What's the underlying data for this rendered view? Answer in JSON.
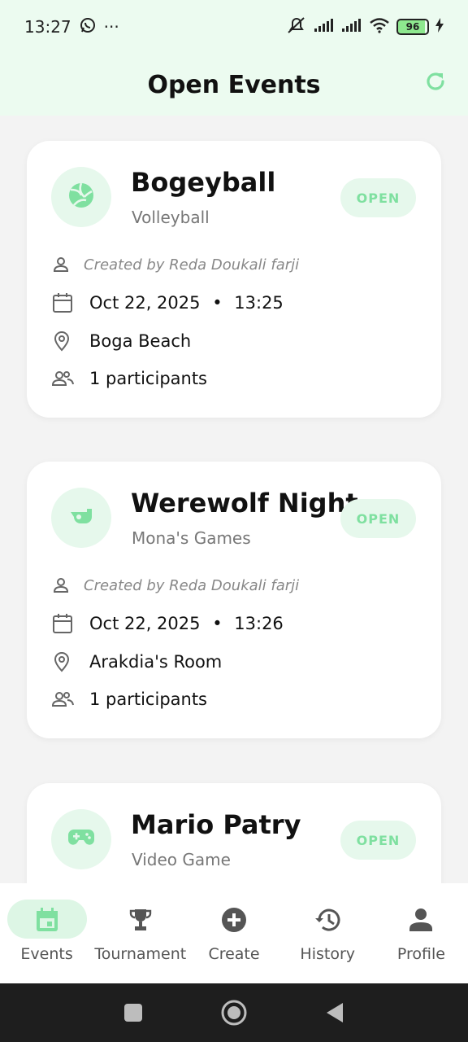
{
  "status_bar": {
    "time": "13:27",
    "more": "···",
    "battery": "96"
  },
  "header": {
    "title": "Open Events"
  },
  "events": [
    {
      "title": "Bogeyball",
      "category": "Volleyball",
      "icon": "volleyball-icon",
      "status": "OPEN",
      "creator": "Created by Reda Doukali farji",
      "date": "Oct 22, 2025",
      "separator": "•",
      "time": "13:25",
      "location": "Boga Beach",
      "participants": "1 participants"
    },
    {
      "title": "Werewolf Night",
      "category": "Mona's Games",
      "icon": "whistle-icon",
      "status": "OPEN",
      "creator": "Created by Reda Doukali farji",
      "date": "Oct 22, 2025",
      "separator": "•",
      "time": "13:26",
      "location": "Arakdia's Room",
      "participants": "1 participants"
    },
    {
      "title": "Mario Patry",
      "category": "Video Game",
      "icon": "gamepad-icon",
      "status": "OPEN"
    }
  ],
  "bottom_nav": {
    "items": [
      {
        "label": "Events",
        "icon": "calendar-icon",
        "active": true
      },
      {
        "label": "Tournament",
        "icon": "trophy-icon",
        "active": false
      },
      {
        "label": "Create",
        "icon": "plus-circle-icon",
        "active": false
      },
      {
        "label": "History",
        "icon": "history-icon",
        "active": false
      },
      {
        "label": "Profile",
        "icon": "person-icon",
        "active": false
      }
    ]
  },
  "colors": {
    "accent": "#7fe0a0",
    "accent_bg": "#e6f8ec",
    "header_bg": "#ecfbf0",
    "page_bg": "#f3f3f3"
  }
}
